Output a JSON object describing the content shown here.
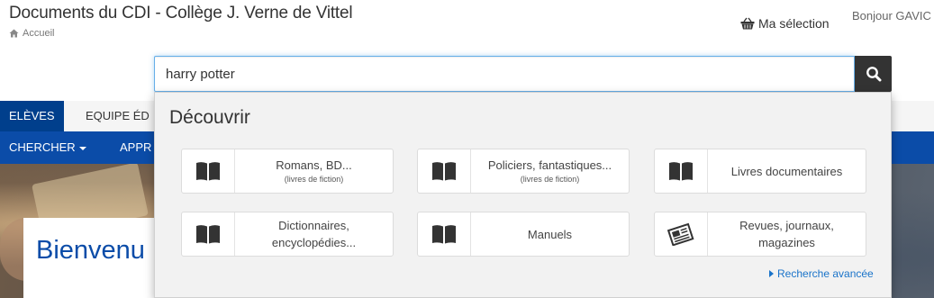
{
  "header": {
    "site_title": "Documents du CDI - Collège J. Verne de Vittel",
    "breadcrumb": "Accueil",
    "selection_label": "Ma sélection",
    "greeting": "Bonjour GAVIC"
  },
  "search": {
    "value": "harry potter"
  },
  "nav": {
    "tabs": [
      {
        "label": "ELÈVES"
      },
      {
        "label": "EQUIPE ÉD"
      }
    ],
    "menu": [
      {
        "label": "CHERCHER"
      },
      {
        "label": "APPR"
      }
    ]
  },
  "hero": {
    "title": "Bienvenu"
  },
  "dropdown": {
    "title": "Découvrir",
    "cards": [
      {
        "label": "Romans, BD...",
        "sub": "(livres de fiction)",
        "icon": "book-icon"
      },
      {
        "label": "Policiers, fantastiques...",
        "sub": "(livres de fiction)",
        "icon": "book-icon"
      },
      {
        "label": "Livres documentaires",
        "sub": "",
        "icon": "book-icon"
      },
      {
        "label": "Dictionnaires, encyclopédies...",
        "sub": "",
        "icon": "book-icon"
      },
      {
        "label": "Manuels",
        "sub": "",
        "icon": "book-icon"
      },
      {
        "label": "Revues, journaux, magazines",
        "sub": "",
        "icon": "newspaper-icon"
      }
    ],
    "advanced_search": "Recherche avancée"
  },
  "colors": {
    "nav_dark": "#003f8c",
    "nav_blue": "#0b4ca8",
    "link": "#1a73c9",
    "search_button": "#333333"
  }
}
